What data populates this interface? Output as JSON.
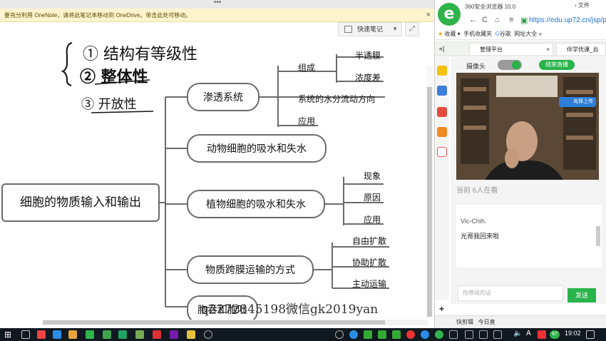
{
  "onenote": {
    "top_dots": "•••",
    "banner": "要充分利用 OneNote，请将此笔记本移动到 OneDrive。单击此处可移动。",
    "banner_close": "×",
    "quick_notes": "快速笔记",
    "handwriting": {
      "line1": "① 结构有等级性",
      "line2": "② 整体性",
      "line3": "③ 开放性"
    },
    "mindmap": {
      "root": "细胞的物质输入和输出",
      "branches": [
        {
          "label": "渗透系统"
        },
        {
          "label": "动物细胞的吸水和失水"
        },
        {
          "label": "植物细胞的吸水和失水"
        },
        {
          "label": "物质跨膜运输的方式"
        },
        {
          "label": "胞吞和胞吐"
        }
      ],
      "osmosis_children": [
        "组成",
        "系统的水分流动方向",
        "应用"
      ],
      "composition_children": [
        "半透膜",
        "浓度差"
      ],
      "plant_children": [
        "现象",
        "原因",
        "应用"
      ],
      "transport_children": [
        "自由扩散",
        "协助扩散",
        "主动运输"
      ]
    },
    "watermark": "q2272845198微信gk2019yan"
  },
  "browser": {
    "title": "360安全浏览器 10.0",
    "menu_file": "文件",
    "url": "https://edu.up72.cn/jsp/p",
    "bookmarks": [
      "收藏",
      "手机收藏夹",
      "谷歌",
      "网址大全"
    ],
    "tabs": [
      {
        "label": "管理平台"
      },
      {
        "label": "伴学优课_云"
      }
    ],
    "live": {
      "camera_label": "摄像头",
      "camera_on": true,
      "end_live": "结束直播",
      "upload": "岛择上传",
      "viewers": "当前 6人在看"
    },
    "chat": {
      "user": "Vic-Chih.",
      "message": "光哥我回来啦",
      "input_placeholder": "你想说的话",
      "send": "发送"
    },
    "status_left": "快剪辑",
    "status_mid": "今日直"
  },
  "taskbar": {
    "time": "19:02",
    "ime": "A",
    "badge": "67"
  },
  "colors": {
    "green": "#28b44a",
    "banner_bg": "#fff4ce",
    "taskbar_bg": "#101820",
    "node_border": "#6b6b6b"
  }
}
